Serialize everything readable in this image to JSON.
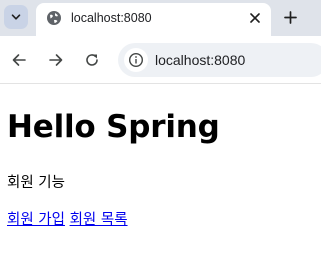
{
  "tab": {
    "title": "localhost:8080"
  },
  "toolbar": {
    "url": "localhost:8080"
  },
  "page": {
    "heading": "Hello Spring",
    "subtitle": "회원 기능",
    "links": [
      "회원 가입",
      "회원 목록"
    ]
  },
  "icons": {
    "tab_search": "chevron-down-icon",
    "favicon": "globe-icon",
    "close": "close-icon",
    "new_tab": "plus-icon",
    "back": "back-arrow-icon",
    "forward": "forward-arrow-icon",
    "reload": "reload-icon",
    "site_info": "info-icon"
  },
  "colors": {
    "tabstrip": "#dfe3ea",
    "omnibox": "#eef1f5",
    "link": "#0000ee"
  }
}
